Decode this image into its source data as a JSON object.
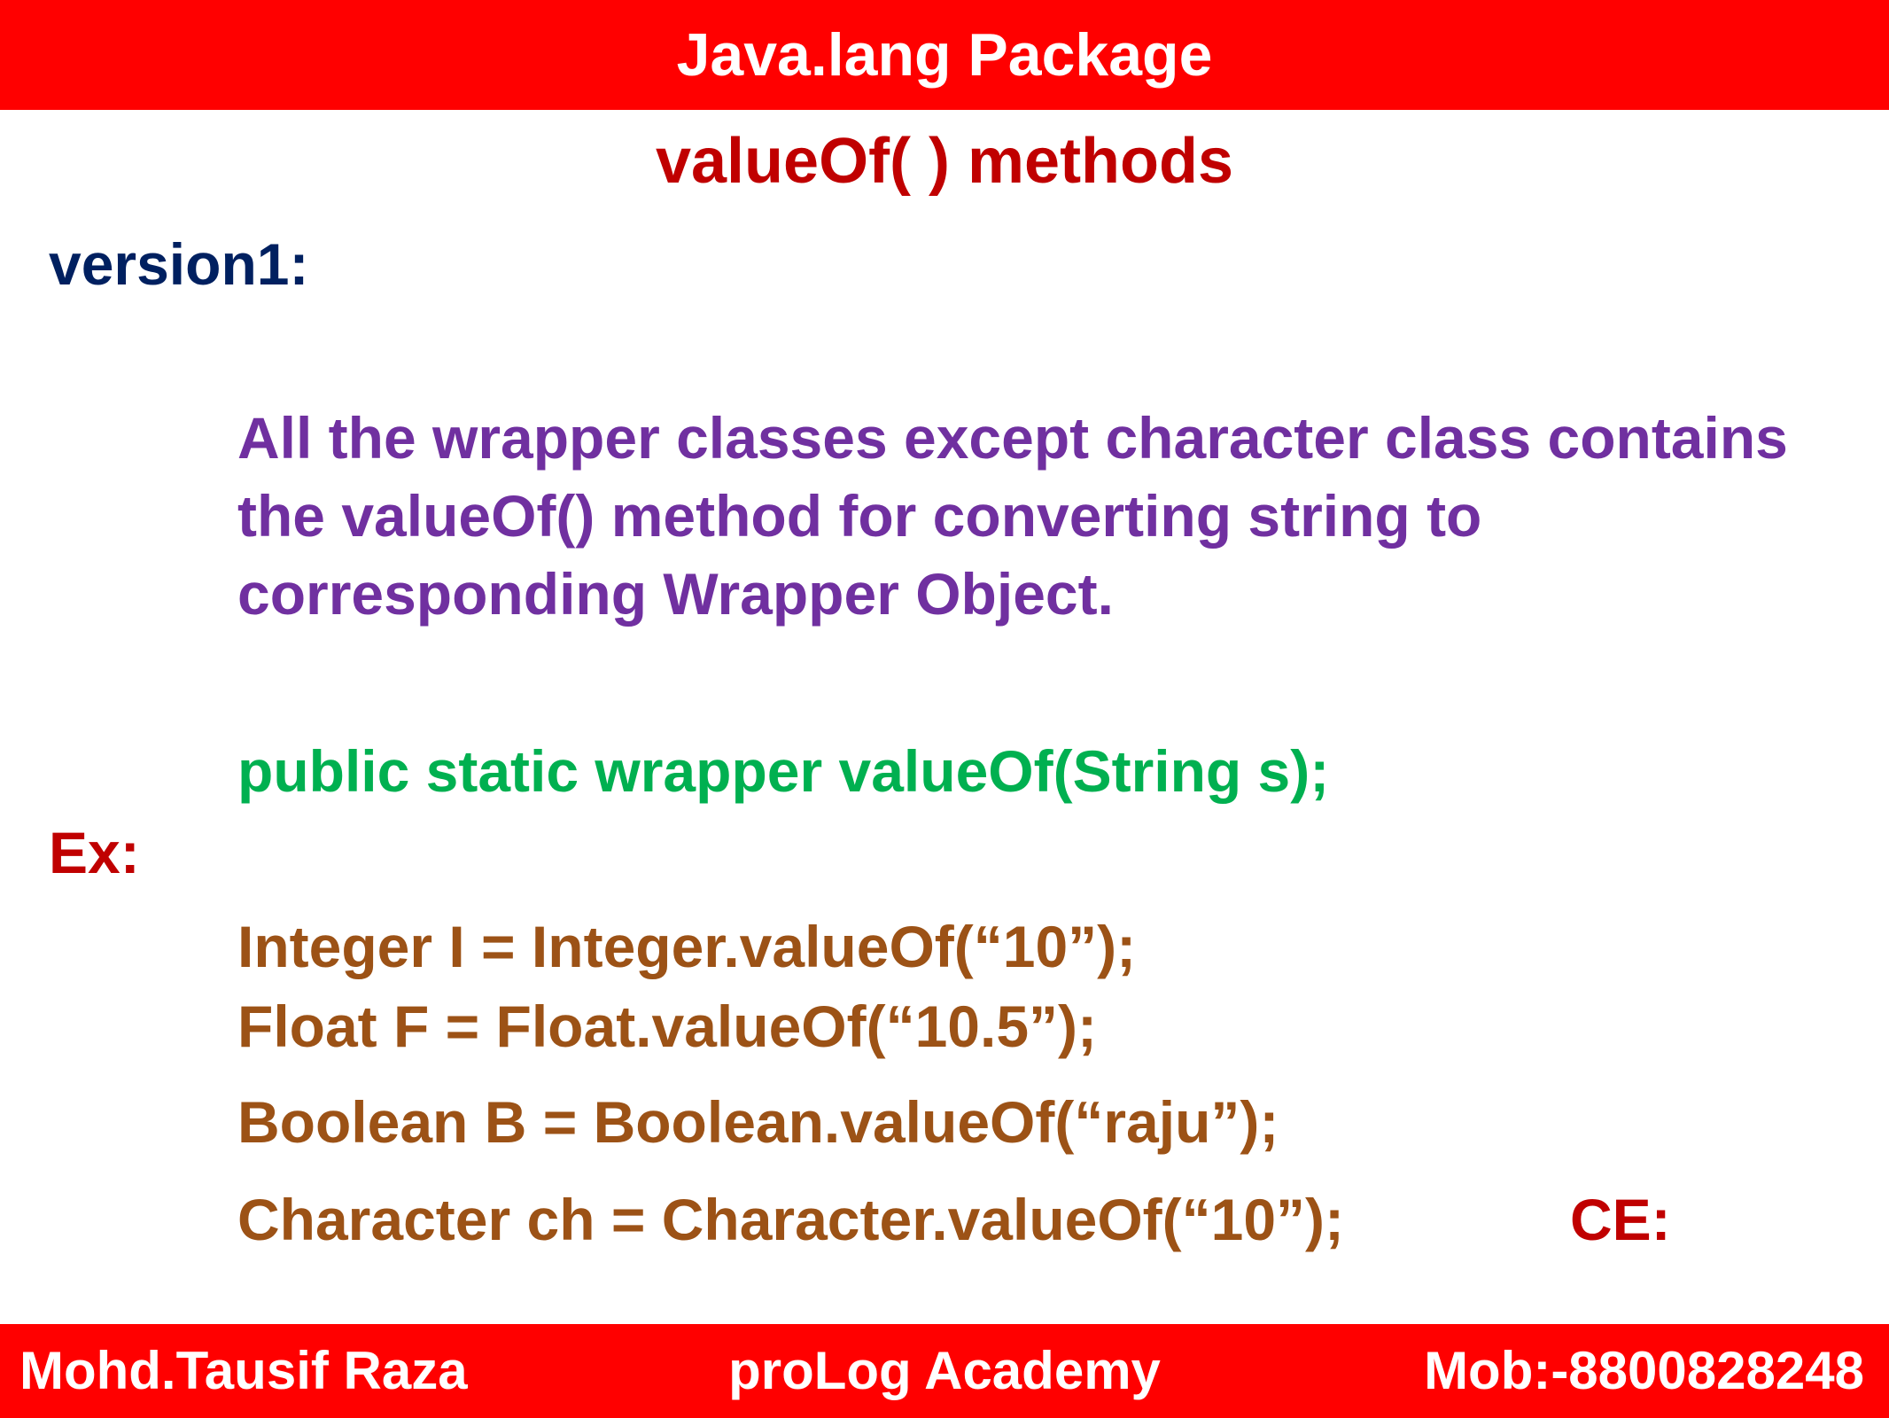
{
  "header": {
    "title": "Java.lang Package"
  },
  "slide": {
    "subtitle": "valueOf( ) methods",
    "version_label": "version1:",
    "description": "All the wrapper classes except character class contains the valueOf() method for converting string to corresponding Wrapper Object.",
    "signature": "public static wrapper valueOf(String s);",
    "example_label": "Ex:",
    "code_lines": [
      "Integer I = Integer.valueOf(“10”);",
      "Float F = Float.valueOf(“10.5”);",
      "Boolean B = Boolean.valueOf(“raju”);",
      "Character ch = Character.valueOf(“10”);"
    ],
    "ce_label": "CE:"
  },
  "footer": {
    "author": "Mohd.Tausif Raza",
    "academy": "proLog Academy",
    "mobile": "Mob:-8800828248"
  },
  "colors": {
    "banner": "#ff0000",
    "subtitle": "#c00000",
    "version_label": "#002060",
    "description": "#7030a0",
    "signature": "#00b050",
    "code": "#9c5216"
  }
}
